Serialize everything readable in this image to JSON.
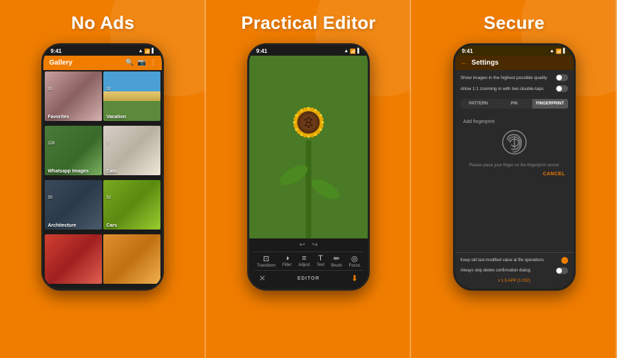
{
  "panels": [
    {
      "title": "No Ads",
      "type": "gallery",
      "statusTime": "9:41",
      "appTitle": "Gallery",
      "items": [
        {
          "label": "Favorites",
          "count": "20",
          "imgClass": "img-face"
        },
        {
          "label": "Vacation",
          "count": "32",
          "imgClass": "img-beach"
        },
        {
          "label": "Whatsapp Images",
          "count": "128",
          "imgClass": "img-plants"
        },
        {
          "label": "Cats",
          "count": "7",
          "imgClass": "img-cat"
        },
        {
          "label": "Architecture",
          "count": "20",
          "imgClass": "img-building"
        },
        {
          "label": "Cars",
          "count": "32",
          "imgClass": "img-car"
        },
        {
          "label": "",
          "count": "",
          "imgClass": "img-art1"
        },
        {
          "label": "",
          "count": "",
          "imgClass": "img-art2"
        }
      ]
    },
    {
      "title": "Practical Editor",
      "type": "editor",
      "statusTime": "9:41",
      "tools": [
        {
          "label": "Transform",
          "icon": "⊡"
        },
        {
          "label": "Filter",
          "icon": "◑"
        },
        {
          "label": "Adjust",
          "icon": "⊞"
        },
        {
          "label": "Text",
          "icon": "T"
        },
        {
          "label": "Brush",
          "icon": "✏"
        },
        {
          "label": "Focus",
          "icon": "◎"
        }
      ],
      "bottomLabel": "EDITOR"
    },
    {
      "title": "Secure",
      "type": "settings",
      "statusTime": "9:41",
      "appTitle": "Settings",
      "settingsRows": [
        {
          "text": "Show images in the highest possible quality",
          "toggle": false
        },
        {
          "text": "Allow 1:1 zooming in with two double-taps",
          "toggle": false
        }
      ],
      "authTabs": [
        "PATTERN",
        "PIN",
        "FINGERPRINT"
      ],
      "activeTab": 2,
      "addFingerprintLabel": "Add fingerprint",
      "fingerprintHint": "Please place your finger on the fingerprint sensor",
      "cancelLabel": "CANCEL",
      "bottomRows": [
        {
          "text": "Keep old last-modified value at file operations",
          "type": "dot"
        },
        {
          "text": "Always skip delete confirmation dialog",
          "toggle": false
        }
      ],
      "versionText": "v 1.5 APP (1.002)"
    }
  ]
}
